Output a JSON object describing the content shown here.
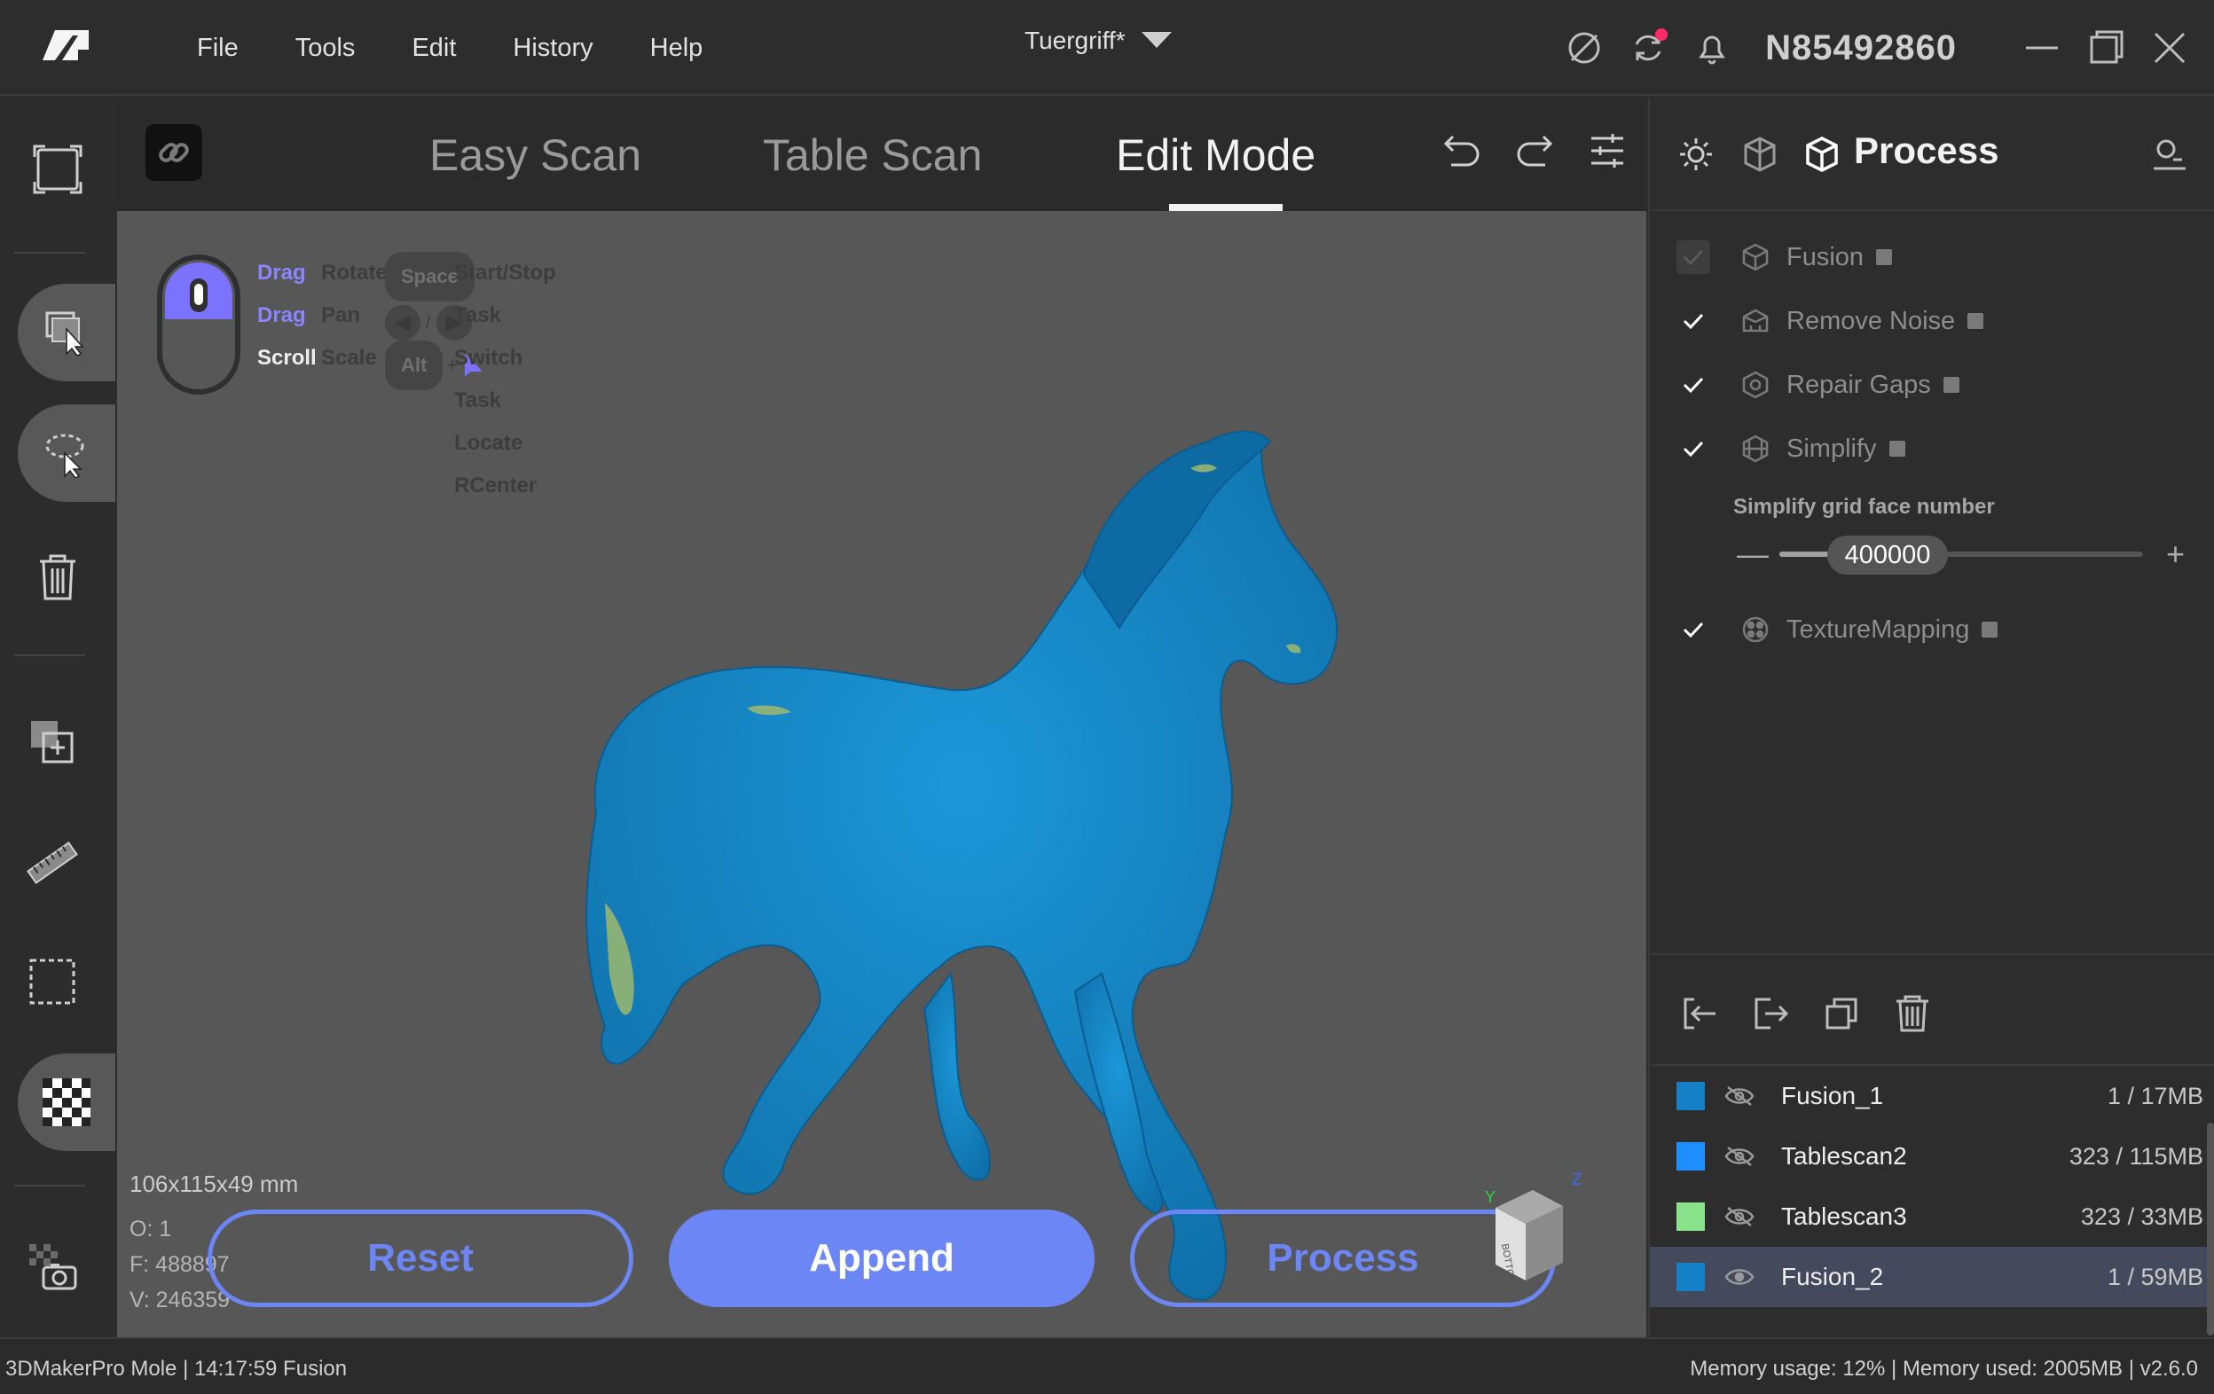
{
  "titlebar": {
    "menu": [
      "File",
      "Tools",
      "Edit",
      "History",
      "Help"
    ],
    "project_name": "Tuergriff*",
    "device_id": "N85492860",
    "icons": [
      "sync-icon",
      "refresh-icon",
      "bell-icon",
      "minimize-icon",
      "maximize-icon",
      "close-icon"
    ]
  },
  "modes": {
    "tabs": [
      "Easy Scan",
      "Table Scan",
      "Edit Mode"
    ],
    "active": "Edit Mode"
  },
  "hints": {
    "mouse": [
      {
        "key": "Drag",
        "action": "Rotate"
      },
      {
        "key": "Drag",
        "action": "Pan"
      },
      {
        "key": "Scroll",
        "action": "Scale"
      }
    ],
    "keys": [
      {
        "key": "Space",
        "action": "Start/Stop Task"
      },
      {
        "key": "← / →",
        "action": "Switch Task"
      },
      {
        "key": "Alt",
        "action": "Locate RCenter"
      }
    ],
    "slash": "/",
    "plus": "+"
  },
  "viewport": {
    "dimensions": "106x115x49 mm",
    "stats": [
      "O: 1",
      "F: 488897",
      "V: 246359"
    ],
    "model_color": "#1a86c4",
    "buttons": {
      "reset": "Reset",
      "append": "Append",
      "process": "Process"
    },
    "axes": {
      "y": "Y",
      "z": "Z"
    },
    "cube_label": "BOTTOM"
  },
  "process_panel": {
    "title": "Process",
    "steps": [
      {
        "label": "Fusion",
        "checked": true,
        "disabled": true
      },
      {
        "label": "Remove Noise",
        "checked": true,
        "disabled": false
      },
      {
        "label": "Repair Gaps",
        "checked": true,
        "disabled": false
      },
      {
        "label": "Simplify",
        "checked": true,
        "disabled": false
      },
      {
        "label": "TextureMapping",
        "checked": true,
        "disabled": false
      }
    ],
    "simplify": {
      "label": "Simplify grid face number",
      "value": "400000",
      "minus": "—",
      "plus": "+",
      "level": 0.15
    }
  },
  "layers": [
    {
      "name": "Fusion_1",
      "size": "1 / 17MB",
      "color": "#1580c6",
      "visible": false,
      "selected": false
    },
    {
      "name": "Tablescan2",
      "size": "323 / 115MB",
      "color": "#1f8fff",
      "visible": false,
      "selected": false
    },
    {
      "name": "Tablescan3",
      "size": "323 / 33MB",
      "color": "#8ae38a",
      "visible": false,
      "selected": false
    },
    {
      "name": "Fusion_2",
      "size": "1 / 59MB",
      "color": "#1580c6",
      "visible": true,
      "selected": true
    }
  ],
  "status": {
    "left": "3DMakerPro Mole  |  14:17:59 Fusion",
    "right": "Memory usage: 12% | Memory used: 2005MB | v2.6.0"
  }
}
